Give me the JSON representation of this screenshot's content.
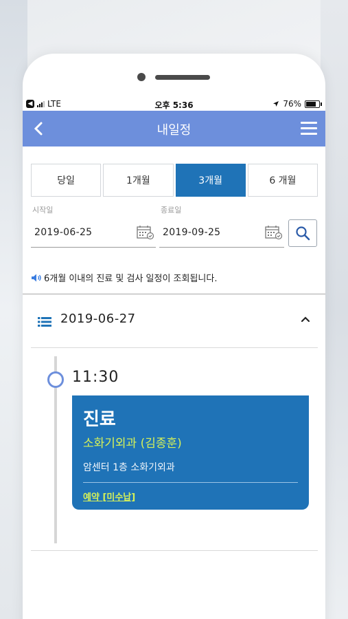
{
  "status_bar": {
    "carrier": "LTE",
    "time": "오후 5:36",
    "battery": "76%",
    "battery_level": 0.76
  },
  "header": {
    "title": "내일정"
  },
  "period_tabs": [
    {
      "label": "당일",
      "active": false
    },
    {
      "label": "1개월",
      "active": false
    },
    {
      "label": "3개월",
      "active": true
    },
    {
      "label": "6 개월",
      "active": false
    }
  ],
  "date_range": {
    "start_label": "시작일",
    "start_value": "2019-06-25",
    "end_label": "종료일",
    "end_value": "2019-09-25"
  },
  "notice": "6개월 이내의 진료 및 검사 일정이 조회됩니다.",
  "schedule": {
    "date": "2019-06-27",
    "time": "11:30",
    "card": {
      "type": "진료",
      "department": "소화기외과 (김종훈)",
      "location": "암센터 1층 소화기외과",
      "status": "예약 [미수납]"
    }
  },
  "colors": {
    "nav_bar": "#6d8fdc",
    "primary": "#1f73b7",
    "highlight": "#d6f158"
  }
}
